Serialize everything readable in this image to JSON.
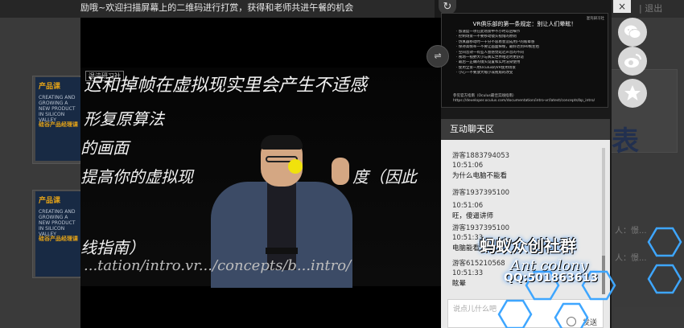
{
  "top_bar": {
    "right_links": "| 退出"
  },
  "marquee": {
    "text": "励哦~欢迎扫描屏幕上的二维码进行打赏，获得和老师共进午餐的机会"
  },
  "background_cards": [
    {
      "title": "产品课",
      "body": "CREATING AND GROWING A NEW PRODUCT IN SILICON VALLEY",
      "subtitle": "硅谷产品经理课"
    },
    {
      "title": "产品课",
      "body": "CREATING AND GROWING A NEW PRODUCT IN SILICON VALLEY",
      "subtitle": "硅谷产品经理课"
    }
  ],
  "background_right": {
    "partial_word": "表",
    "dots_1": "人：憬...",
    "dots_2": "人：憬..."
  },
  "video": {
    "logo": "混沌研习社",
    "slide_lines": [
      "迟和掉帧在虚拟现实里会产生不适感",
      "形复原算法",
      "的画面",
      "提高你的虚拟现",
      "度（因此",
      "线指南）",
      "...tation/intro.vr.../concepts/b...intro/"
    ]
  },
  "ad_panel": {
    "brand": "混沌研习社",
    "title": "VR俱乐部的第一条规定：别让人们晕眩！",
    "items": [
      "· 加速度一项在此场景中不小时以后细节",
      "· 控制场景一不要移动镜头视角的原则",
      "· 仿真器移动时一十分不容易会造成用户的眩晕感",
      "· 保持高帧率一不要让画面掉帧，最好达到90帧左右",
      "· 空间音效一有些人会感觉延迟声音的不同",
      "· 视场一视野大小与真实世界相近时更舒适",
      "· 最后一正确的镜头设置和实时渲染使用",
      "· 使用全景一用Oculus的VR使用场景",
      "· 小心一不要放大缩小或视角的改变"
    ],
    "footer": "参见官方指南（Oculus最佳实践指南）https://developer.oculus.com/documentation/intro-vr/latest/concepts/bp_intro/"
  },
  "switch_icon_label": "⇌",
  "chat": {
    "header": "互动聊天区",
    "messages": [
      {
        "user": "游客1883794053",
        "time": "10:51:06",
        "text": "为什么电脑不能看"
      },
      {
        "user": "游客1937395100",
        "time": "10:51:06",
        "text": "旺，傻逼讲师"
      },
      {
        "user": "游客1937395100",
        "time": "10:51:33",
        "text": "电脑能看"
      },
      {
        "user": "游客615210568",
        "time": "10:51:33",
        "text": "眩晕"
      }
    ],
    "input_placeholder": "说点儿什么吧",
    "send_label": "发送"
  },
  "watermark": {
    "line1": "蚂蚁众创社群",
    "line2": "Ant colony",
    "line3": "QQ:501863613"
  },
  "close_label": "×",
  "colors": {
    "accent_yellow": "#f0e20c",
    "watermark_blue": "#2a8cff",
    "chat_bg": "#e9e9e9"
  }
}
